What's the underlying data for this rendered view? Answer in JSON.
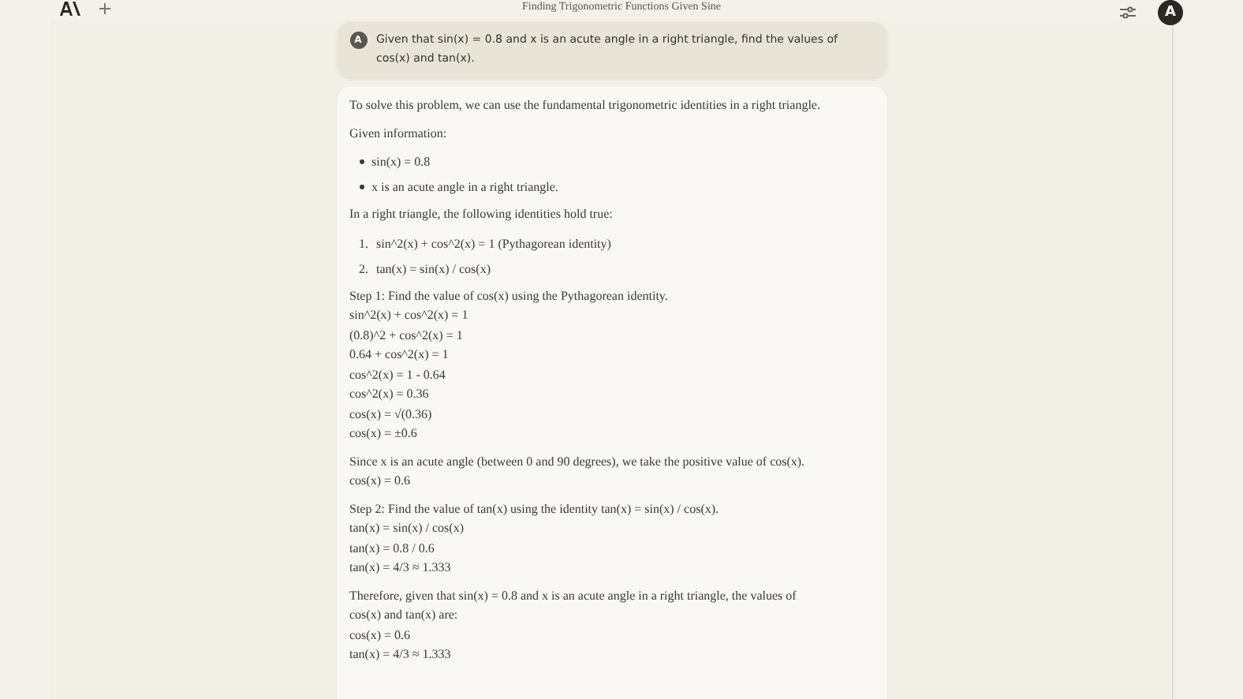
{
  "header": {
    "title": "Finding Trigonometric Functions Given Sine",
    "avatar": "A"
  },
  "user_message": {
    "avatar": "A",
    "text": "Given that sin(x) = 0.8 and x is an acute angle in a right triangle, find the values of cos(x) and tan(x)."
  },
  "response": [
    {
      "kind": "para",
      "lines": [
        "To solve this problem, we can use the fundamental trigonometric identities in a right triangle."
      ]
    },
    {
      "kind": "para",
      "lines": [
        "Given information:"
      ]
    },
    {
      "kind": "bullets",
      "items": [
        "sin(x) = 0.8",
        "x is an acute angle in a right triangle."
      ]
    },
    {
      "kind": "para",
      "lines": [
        "In a right triangle, the following identities hold true:"
      ]
    },
    {
      "kind": "numbered",
      "items": [
        {
          "number": "1.",
          "text": "sin^2(x) + cos^2(x) = 1 (Pythagorean identity)"
        },
        {
          "number": "2.",
          "text": "tan(x) = sin(x) / cos(x)"
        }
      ]
    },
    {
      "kind": "para",
      "lines": [
        "Step 1: Find the value of cos(x) using the Pythagorean identity.",
        "sin^2(x) + cos^2(x) = 1",
        "(0.8)^2 + cos^2(x) = 1",
        "0.64 + cos^2(x) = 1",
        "cos^2(x) = 1 - 0.64",
        "cos^2(x) = 0.36",
        "cos(x) = √(0.36)",
        "cos(x) = ±0.6"
      ]
    },
    {
      "kind": "para",
      "lines": [
        "Since x is an acute angle (between 0 and 90 degrees), we take the positive value of cos(x).",
        "cos(x) = 0.6"
      ]
    },
    {
      "kind": "para",
      "lines": [
        "Step 2: Find the value of tan(x) using the identity tan(x) = sin(x) / cos(x).",
        "tan(x) = sin(x) / cos(x)",
        "tan(x) = 0.8 / 0.6",
        "tan(x) = 4/3 ≈ 1.333"
      ]
    },
    {
      "kind": "para",
      "lines": [
        "Therefore, given that sin(x) = 0.8 and x is an acute angle in a right triangle, the values of cos(x) and tan(x) are:",
        "cos(x) = 0.6",
        "tan(x) = 4/3 ≈ 1.333"
      ]
    }
  ]
}
